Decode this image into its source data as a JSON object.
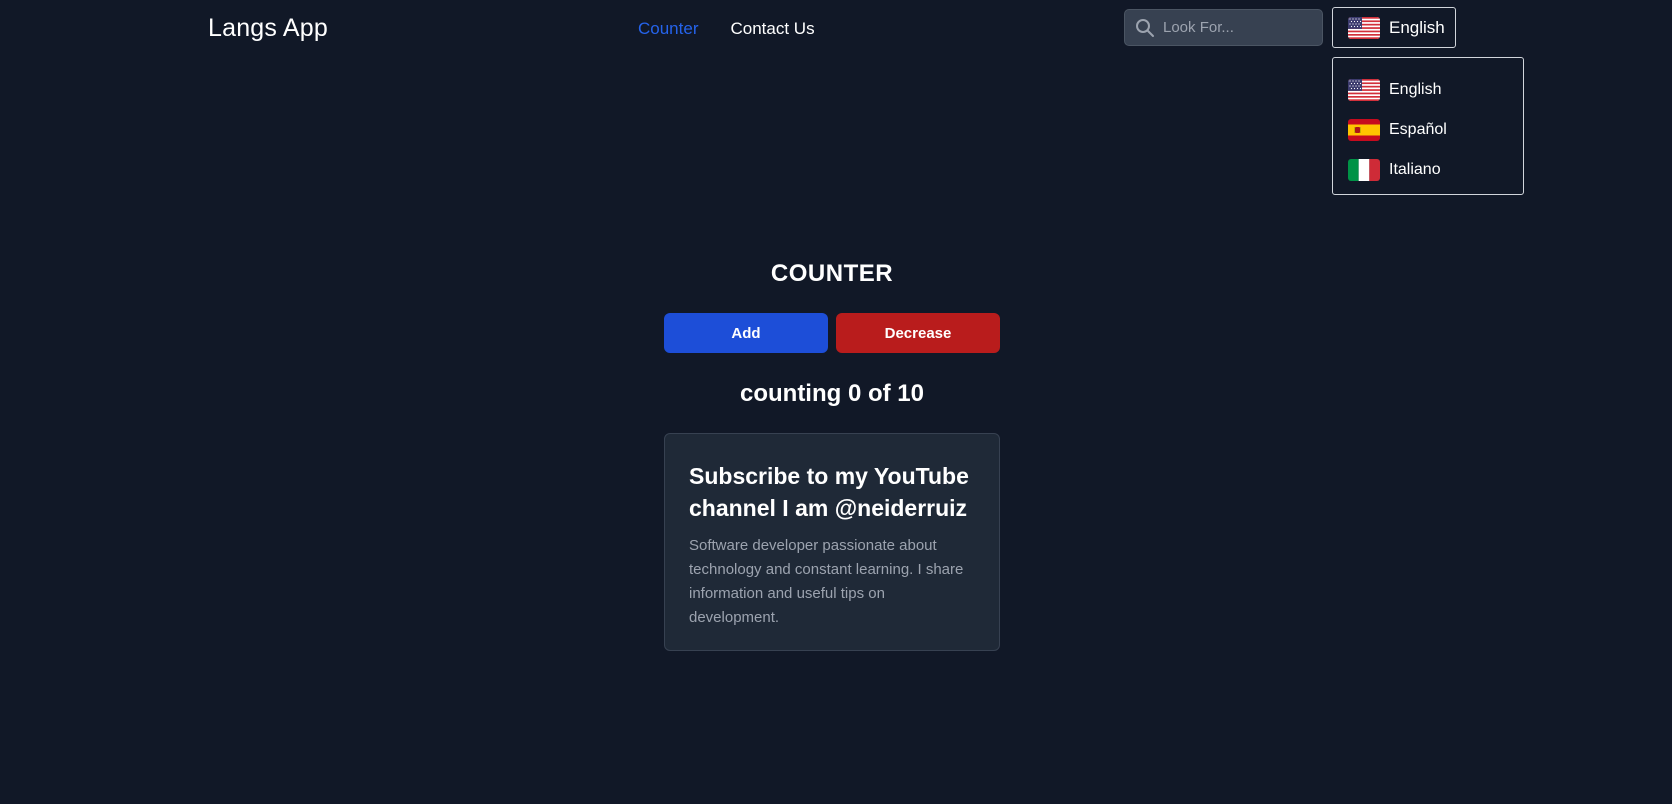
{
  "navbar": {
    "brand": "Langs App",
    "links": [
      {
        "label": "Counter",
        "active": true
      },
      {
        "label": "Contact Us",
        "active": false
      }
    ],
    "search": {
      "placeholder": "Look For...",
      "value": "",
      "icon": "search-icon"
    },
    "language": {
      "selected": "English",
      "selected_flag": "us-flag-icon",
      "options": [
        {
          "label": "English",
          "flag": "us-flag-icon"
        },
        {
          "label": "Español",
          "flag": "es-flag-icon"
        },
        {
          "label": "Italiano",
          "flag": "it-flag-icon"
        }
      ]
    }
  },
  "counter": {
    "title": "COUNTER",
    "add_label": "Add",
    "decrease_label": "Decrease",
    "counting_text": "counting 0 of 10"
  },
  "card": {
    "title": "Subscribe to my YouTube channel I am @neiderruiz",
    "description": "Software developer passionate about technology and constant learning. I share information and useful tips on development."
  },
  "colors": {
    "background": "#111827",
    "card_background": "#1f2937",
    "accent_blue": "#1d4ed8",
    "active_link": "#2563eb",
    "danger_red": "#b91c1c",
    "muted_text": "#9ca3af"
  }
}
